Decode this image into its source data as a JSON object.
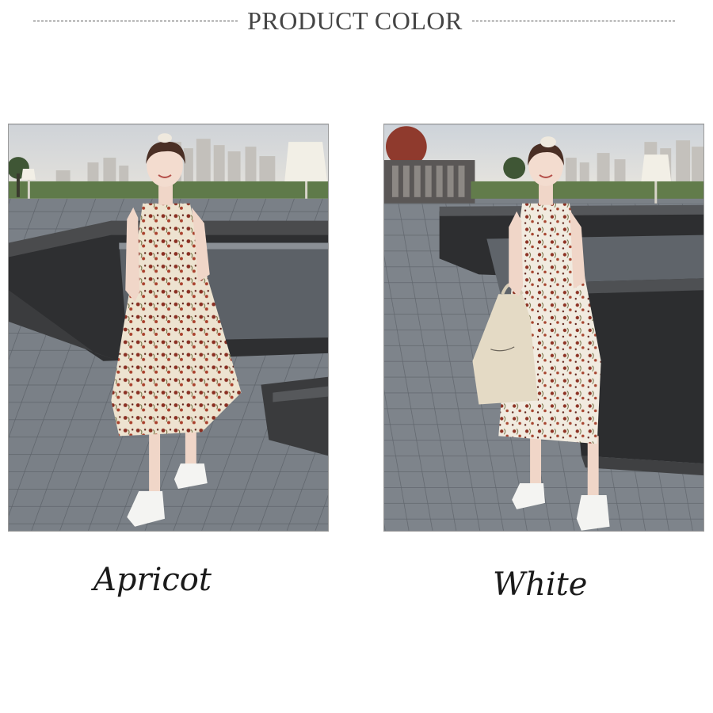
{
  "header": {
    "title": "PRODUCT COLOR"
  },
  "products": [
    {
      "color_name": "Apricot",
      "image_icon": "photo-model-floral-dress"
    },
    {
      "color_name": "White",
      "image_icon": "photo-model-floral-dress-with-tote"
    }
  ],
  "colors": {
    "text": "#1a1a1a",
    "header_text": "#444444",
    "divider": "#555555",
    "photo_border": "#9a9a9a"
  }
}
